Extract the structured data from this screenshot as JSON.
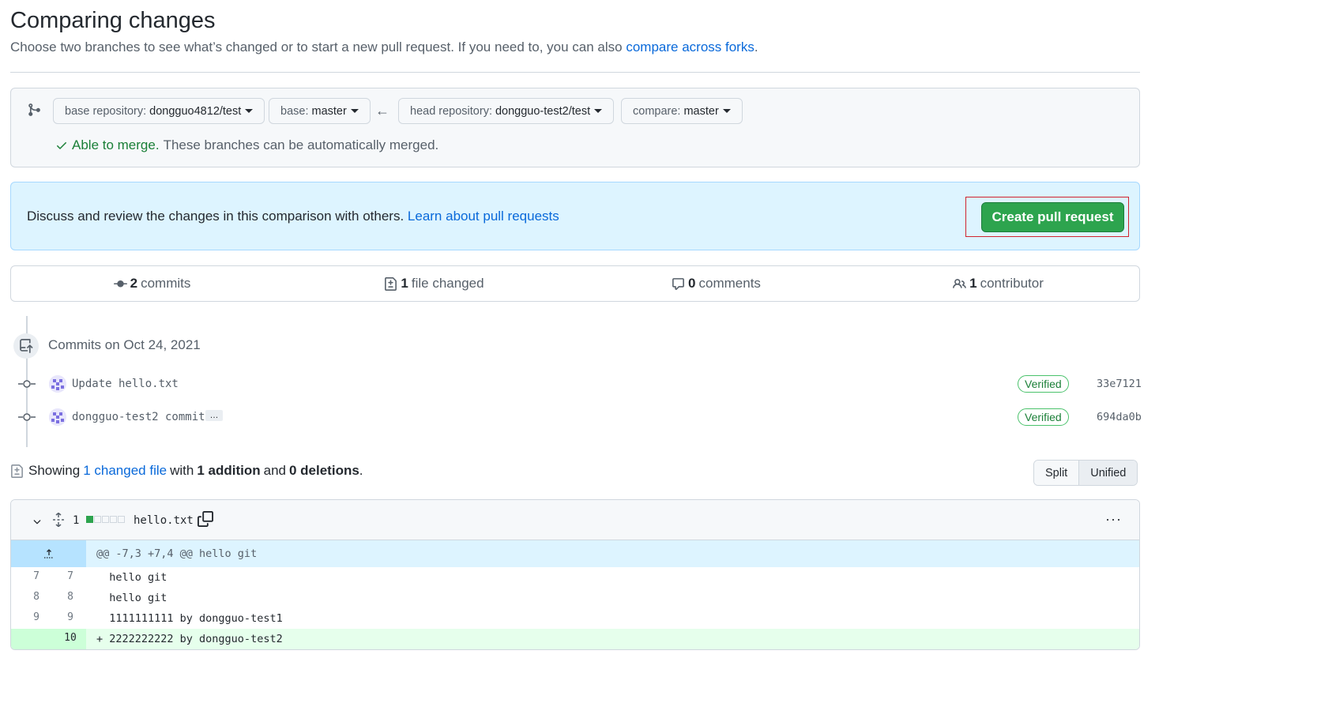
{
  "header": {
    "title": "Comparing changes",
    "subtitle": "Choose two branches to see what’s changed or to start a new pull request. If you need to, you can also",
    "subtitle_link": "compare across forks",
    "subtitle_end": "."
  },
  "range": {
    "base_repo_label": "base repository:",
    "base_repo_value": "dongguo4812/test",
    "base_label": "base:",
    "base_value": "master",
    "head_repo_label": "head repository:",
    "head_repo_value": "dongguo-test2/test",
    "compare_label": "compare:",
    "compare_value": "master",
    "merge_ok": "Able to merge.",
    "merge_text": "These branches can be automatically merged."
  },
  "discuss": {
    "text": "Discuss and review the changes in this comparison with others.",
    "link": "Learn about pull requests",
    "create_button": "Create pull request"
  },
  "summary": {
    "commits_count": "2",
    "commits_label": "commits",
    "files_count": "1",
    "files_label": "file changed",
    "comments_count": "0",
    "comments_label": "comments",
    "contributors_count": "1",
    "contributors_label": "contributor"
  },
  "commits": {
    "date_heading": "Commits on Oct 24, 2021",
    "items": [
      {
        "message": "Update hello.txt",
        "verified": "Verified",
        "sha": "33e7121"
      },
      {
        "message": "dongguo-test2 commit",
        "ellipsis": "…",
        "verified": "Verified",
        "sha": "694da0b"
      }
    ]
  },
  "file_summary": {
    "showing": "Showing",
    "changed_link": "1 changed file",
    "with": "with",
    "additions": "1 addition",
    "and": "and",
    "deletions": "0 deletions",
    "period": ".",
    "split": "Split",
    "unified": "Unified"
  },
  "diff": {
    "change_count": "1",
    "filename": "hello.txt",
    "more": "···",
    "hunk_header": "@@ -7,3 +7,4 @@ hello git",
    "lines": [
      {
        "old": "7",
        "new": "7",
        "code": "  hello git"
      },
      {
        "old": "8",
        "new": "8",
        "code": "  hello git"
      },
      {
        "old": "9",
        "new": "9",
        "code": "  1111111111 by dongguo-test1"
      },
      {
        "old": "",
        "new": "10",
        "code": "+ 2222222222 by dongguo-test2"
      }
    ]
  },
  "colors": {
    "accent_link": "#0969da",
    "success": "#2da44e",
    "highlight_frame": "#d1242f"
  }
}
